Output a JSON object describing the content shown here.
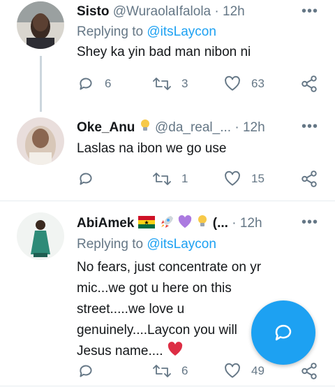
{
  "tweets": [
    {
      "name": "Sisto",
      "handle": "@WuraolaIfalola",
      "dot": "·",
      "time": "12h",
      "reply_prefix": "Replying to",
      "reply_to": "@itsLaycon",
      "text": "Shey ka yin bad man nibon ni",
      "replies": "6",
      "retweets": "3",
      "likes": "63"
    },
    {
      "name": "Oke_Anu",
      "handle": "@da_real_...",
      "dot": "·",
      "time": "12h",
      "text": "Laslas na ibon we go use",
      "retweets": "1",
      "likes": "15"
    },
    {
      "name": "AbiAmek",
      "handle": "(...",
      "dot": "·",
      "time": "12h",
      "reply_prefix": "Replying to",
      "reply_to": "@itsLaycon",
      "text_lines": [
        "No fears, just concentrate on yr",
        "mic...we got u here on this",
        "street.....we love u",
        "genuinely....Laycon you will",
        "Jesus name...."
      ],
      "retweets": "6",
      "likes": "49"
    }
  ],
  "icons": {
    "more": "more-icon",
    "reply": "reply-icon",
    "retweet": "retweet-icon",
    "like": "heart-icon",
    "share": "share-icon",
    "compose": "compose-reply-icon"
  },
  "colors": {
    "accent": "#1da1f2",
    "secondary_text": "#657786",
    "divider": "#e6ecf0"
  }
}
